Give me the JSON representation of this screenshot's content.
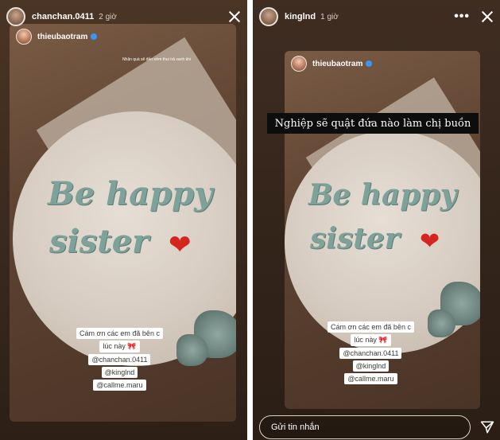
{
  "left_story": {
    "username": "chanchan.0411",
    "time": "2 giờ",
    "card": {
      "username": "thieubaotram",
      "small_caption": "Nhận quà sẽ đến sớm thui trả xanh khi",
      "cake_line1": "Be happy",
      "cake_line2": "sister",
      "mentions": [
        "Cám ơn các em đã bên c",
        "lúc này 🎀",
        "@chanchan.0411",
        "@kinglnd",
        "@callme.maru"
      ]
    }
  },
  "right_story": {
    "username": "kinglnd",
    "time": "1 giờ",
    "card": {
      "username": "thieubaotram",
      "caption": "Nghiệp sẽ quật đứa nào làm chị buồn",
      "cake_line1": "Be happy",
      "cake_line2": "sister",
      "mentions": [
        "Cám ơn các em đã bên c",
        "lúc này 🎀",
        "@chanchan.0411",
        "@kinglnd",
        "@callme.maru"
      ]
    },
    "reply_placeholder": "Gửi tin nhắn"
  },
  "icons": {
    "close": "close-icon",
    "more": "more-icon",
    "send": "send-icon",
    "heart": "heart-icon",
    "verified": "verified-badge-icon"
  },
  "colors": {
    "verified_blue": "#3897f0",
    "heart_red": "#d4251e",
    "frosting_green": "#7ea19a"
  }
}
